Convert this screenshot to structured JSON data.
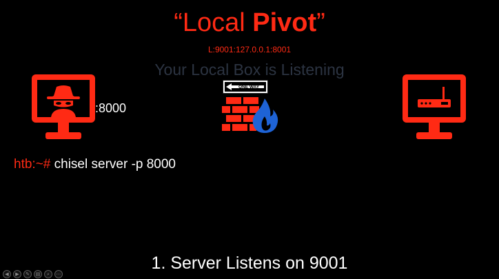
{
  "slide": {
    "title_quote_open": "“",
    "title_regular": "Local ",
    "title_bold": "Pivot",
    "title_quote_close": "”",
    "subtitle": "L:9001:127.0.0.1:8001",
    "tagline": "Your Local Box is Listening",
    "port_label": ":8000",
    "oneway_sign_text": "ONE WAY",
    "command_prompt": "htb:~# ",
    "command_text": "chisel server -p 8000",
    "step_text": "1. Server Listens on 9001"
  },
  "icons": {
    "left_monitor": "hacker-monitor-icon",
    "right_monitor": "router-monitor-icon",
    "firewall": "firewall-icon",
    "oneway": "one-way-sign-icon"
  },
  "controls": [
    "◀",
    "▶",
    "✎",
    "▤",
    "⌕",
    "⋯"
  ],
  "colors": {
    "background": "#000000",
    "accent_red": "#ff2a14",
    "flame_blue": "#1e63d6",
    "tagline": "#2c3442",
    "text": "#ffffff"
  }
}
